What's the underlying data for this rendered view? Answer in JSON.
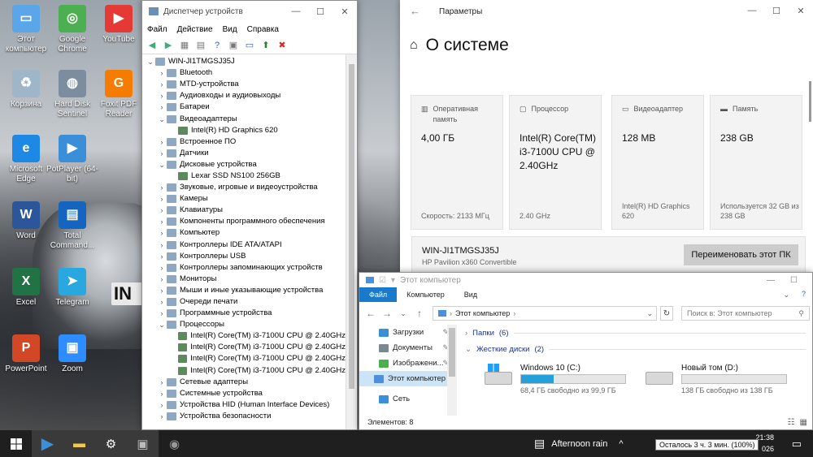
{
  "desktop": {
    "icons": [
      {
        "label": "Этот компьютер",
        "icon": "this-pc-icon",
        "color": "#5aa6e8"
      },
      {
        "label": "Google Chrome",
        "icon": "chrome-icon",
        "color": "#4caf50"
      },
      {
        "label": "YouTube",
        "icon": "youtube-icon",
        "color": "#e53935"
      },
      {
        "label": "Корзина",
        "icon": "recycle-bin-icon",
        "color": "#9fb6c9"
      },
      {
        "label": "Hard Disk Sentinel",
        "icon": "hdd-sentinel-icon",
        "color": "#7d8da0"
      },
      {
        "label": "Foxit PDF Reader",
        "icon": "foxit-icon",
        "color": "#f57c00"
      },
      {
        "label": "Microsoft Edge",
        "icon": "edge-icon",
        "color": "#1e88e5"
      },
      {
        "label": "PotPlayer (64-bit)",
        "icon": "potplayer-icon",
        "color": "#3b8ed8"
      },
      {
        "label": "Word",
        "icon": "word-icon",
        "color": "#2b579a"
      },
      {
        "label": "Total Command...",
        "icon": "total-commander-icon",
        "color": "#1565c0"
      },
      {
        "label": "Excel",
        "icon": "excel-icon",
        "color": "#217346"
      },
      {
        "label": "Telegram",
        "icon": "telegram-icon",
        "color": "#29a8e0"
      },
      {
        "label": "PowerPoint",
        "icon": "powerpoint-icon",
        "color": "#d24726"
      },
      {
        "label": "Zoom",
        "icon": "zoom-icon",
        "color": "#2d8cff"
      }
    ]
  },
  "devmgr": {
    "title": "Диспетчер устройств",
    "menu": [
      "Файл",
      "Действие",
      "Вид",
      "Справка"
    ],
    "tree": [
      {
        "label": "WIN-JI1TMGSJ35J",
        "level": 0,
        "exp": "⌄"
      },
      {
        "label": "Bluetooth",
        "level": 1,
        "exp": "›"
      },
      {
        "label": "MTD-устройства",
        "level": 1,
        "exp": "›"
      },
      {
        "label": "Аудиовходы и аудиовыходы",
        "level": 1,
        "exp": "›"
      },
      {
        "label": "Батареи",
        "level": 1,
        "exp": "›"
      },
      {
        "label": "Видеоадаптеры",
        "level": 1,
        "exp": "⌄"
      },
      {
        "label": "Intel(R) HD Graphics 620",
        "level": 2,
        "exp": ""
      },
      {
        "label": "Встроенное ПО",
        "level": 1,
        "exp": "›"
      },
      {
        "label": "Датчики",
        "level": 1,
        "exp": "›"
      },
      {
        "label": "Дисковые устройства",
        "level": 1,
        "exp": "⌄"
      },
      {
        "label": "Lexar SSD NS100 256GB",
        "level": 2,
        "exp": ""
      },
      {
        "label": "Звуковые, игровые и видеоустройства",
        "level": 1,
        "exp": "›"
      },
      {
        "label": "Камеры",
        "level": 1,
        "exp": "›"
      },
      {
        "label": "Клавиатуры",
        "level": 1,
        "exp": "›"
      },
      {
        "label": "Компоненты программного обеспечения",
        "level": 1,
        "exp": "›"
      },
      {
        "label": "Компьютер",
        "level": 1,
        "exp": "›"
      },
      {
        "label": "Контроллеры IDE ATA/ATAPI",
        "level": 1,
        "exp": "›"
      },
      {
        "label": "Контроллеры USB",
        "level": 1,
        "exp": "›"
      },
      {
        "label": "Контроллеры запоминающих устройств",
        "level": 1,
        "exp": "›"
      },
      {
        "label": "Мониторы",
        "level": 1,
        "exp": "›"
      },
      {
        "label": "Мыши и иные указывающие устройства",
        "level": 1,
        "exp": "›"
      },
      {
        "label": "Очереди печати",
        "level": 1,
        "exp": "›"
      },
      {
        "label": "Программные устройства",
        "level": 1,
        "exp": "›"
      },
      {
        "label": "Процессоры",
        "level": 1,
        "exp": "⌄"
      },
      {
        "label": "Intel(R) Core(TM) i3-7100U CPU @ 2.40GHz",
        "level": 2,
        "exp": ""
      },
      {
        "label": "Intel(R) Core(TM) i3-7100U CPU @ 2.40GHz",
        "level": 2,
        "exp": ""
      },
      {
        "label": "Intel(R) Core(TM) i3-7100U CPU @ 2.40GHz",
        "level": 2,
        "exp": ""
      },
      {
        "label": "Intel(R) Core(TM) i3-7100U CPU @ 2.40GHz",
        "level": 2,
        "exp": ""
      },
      {
        "label": "Сетевые адаптеры",
        "level": 1,
        "exp": "›"
      },
      {
        "label": "Системные устройства",
        "level": 1,
        "exp": "›"
      },
      {
        "label": "Устройства HID (Human Interface Devices)",
        "level": 1,
        "exp": "›"
      },
      {
        "label": "Устройства безопасности",
        "level": 1,
        "exp": "›"
      }
    ]
  },
  "settings": {
    "title": "Параметры",
    "heading": "О системе",
    "cards": [
      {
        "label": "Оперативная память",
        "icon": "memory-icon",
        "value": "4,00 ГБ",
        "footer": "Скорость: 2133 МГц"
      },
      {
        "label": "Процессор",
        "icon": "processor-icon",
        "value": "Intel(R) Core(TM) i3-7100U CPU @ 2.40GHz",
        "footer": "2.40 GHz"
      },
      {
        "label": "Видеоадаптер",
        "icon": "gpu-icon",
        "value": "128 MB",
        "footer": "Intel(R) HD Graphics 620"
      },
      {
        "label": "Память",
        "icon": "storage-icon",
        "value": "238 GB",
        "footer": "Используется 32 GB из 238 GB"
      }
    ],
    "pc_name": "WIN-JI1TMGSJ35J",
    "pc_model": "HP Pavilion x360 Convertible",
    "rename_label": "Переименовать этот ПК"
  },
  "explorer": {
    "title": "Этот компьютер",
    "ribbon": [
      "Файл",
      "Компьютер",
      "Вид"
    ],
    "address": "Этот компьютер",
    "search_placeholder": "Поиск в: Этот компьютер",
    "nav": [
      {
        "label": "Загрузки",
        "pinned": true
      },
      {
        "label": "Документы",
        "pinned": true
      },
      {
        "label": "Изображени...",
        "pinned": true
      },
      {
        "label": "Этот компьютер",
        "pinned": false
      },
      {
        "label": "Сеть",
        "pinned": false
      }
    ],
    "groups": [
      {
        "label": "Папки",
        "count": "(6)",
        "expanded": false
      },
      {
        "label": "Жесткие диски",
        "count": "(2)",
        "expanded": true
      }
    ],
    "drives": [
      {
        "name": "Windows 10 (C:)",
        "free": "68,4 ГБ свободно из 99,9 ГБ",
        "used_fraction": 0.315,
        "bar_color": "#26a0da"
      },
      {
        "name": "Новый том (D:)",
        "free": "138 ГБ свободно из 138 ГБ",
        "used_fraction": 0.0,
        "bar_color": "#26a0da"
      }
    ],
    "status": "Элементов: 8"
  },
  "taskbar": {
    "weather": "Afternoon rain",
    "time": "21:38",
    "date_fragment": "026",
    "battery_tooltip": "Осталось 3 ч. 3 мин. (100%)"
  }
}
